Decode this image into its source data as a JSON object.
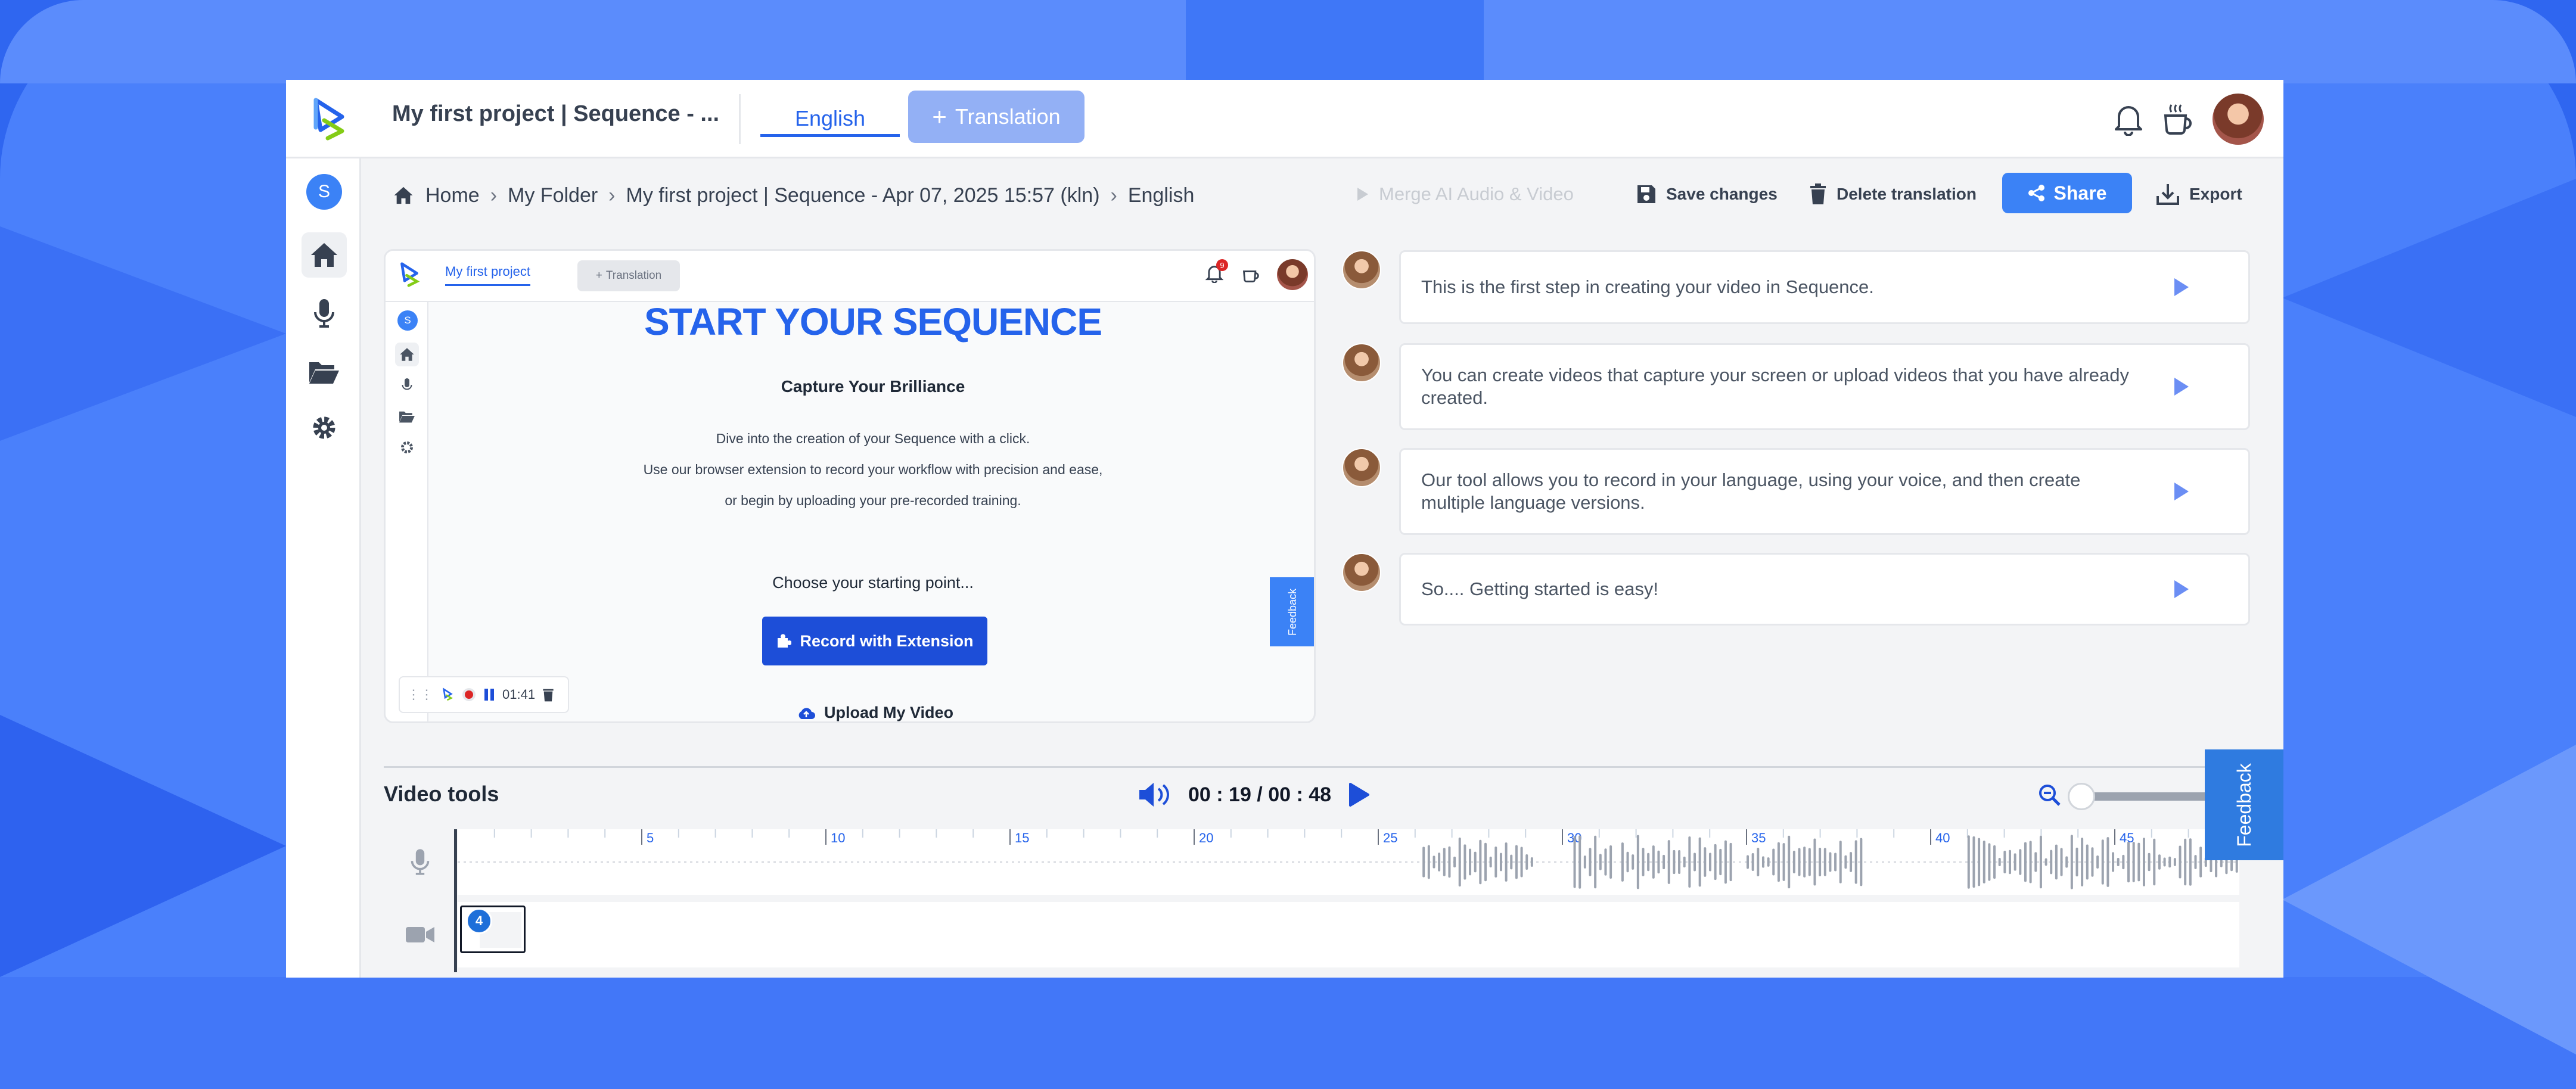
{
  "topbar": {
    "project_title": "My first project | Sequence - ...",
    "language_tab": "English",
    "translation_button": "Translation",
    "icons": [
      "logo-icon",
      "bell-icon",
      "coffee-icon",
      "user-avatar"
    ]
  },
  "sidebar": {
    "user_initial": "S",
    "items": [
      {
        "name": "home",
        "icon": "home-icon",
        "active": true
      },
      {
        "name": "record",
        "icon": "microphone-icon",
        "active": false
      },
      {
        "name": "folders",
        "icon": "folder-open-icon",
        "active": false
      },
      {
        "name": "settings",
        "icon": "gear-icon",
        "active": false
      }
    ],
    "bottom_icon": "add-user-icon"
  },
  "breadcrumb": {
    "home": "Home",
    "folder": "My Folder",
    "project": "My first project | Sequence - Apr 07, 2025 15:57 (kln)",
    "language": "English"
  },
  "actions": {
    "merge": "Merge AI Audio & Video",
    "save": "Save changes",
    "delete": "Delete translation",
    "share": "Share",
    "export": "Export"
  },
  "preview": {
    "tab": "My first project",
    "translation_button": "Translation",
    "notification_count": "9",
    "user_initial": "S",
    "headline": "START YOUR SEQUENCE",
    "subheadline": "Capture Your Brilliance",
    "description_lines": [
      "Dive into the creation of your Sequence with a click.",
      "Use our browser extension to record your workflow with precision and ease,",
      "or begin by uploading your pre-recorded training."
    ],
    "choose": "Choose your starting point...",
    "record_button": "Record with Extension",
    "upload_button": "Upload My Video",
    "feedback": "Feedback",
    "recorder_time": "01:41"
  },
  "script": [
    {
      "text": "This is the first step in creating your video in Sequence."
    },
    {
      "text": "You can create videos that capture your screen or upload videos that you have already created."
    },
    {
      "text": "Our tool allows you to record in your language, using your voice, and then create multiple language versions."
    },
    {
      "text": "So.... Getting started is easy!"
    }
  ],
  "video_tools": {
    "title": "Video tools",
    "time": "00 : 19 / 00 : 48",
    "feedback": "Feedback",
    "ruler_labels": [
      "5",
      "10",
      "15",
      "20",
      "25",
      "30",
      "35",
      "40",
      "45"
    ],
    "clip_count": "4"
  },
  "colors": {
    "accent": "#3b82f6",
    "primary_dark": "#1d4ed8",
    "background": "#2f66f0"
  }
}
